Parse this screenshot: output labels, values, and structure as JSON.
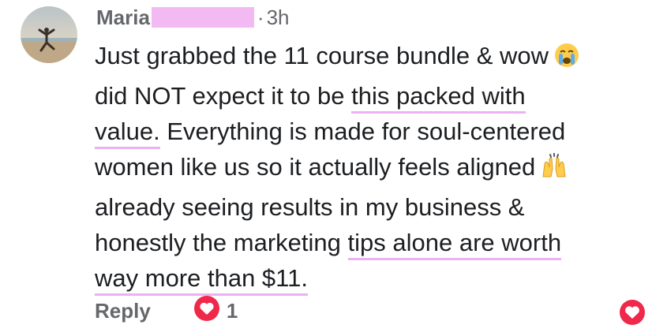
{
  "comment": {
    "author": "Maria",
    "separator": "·",
    "time": "3h",
    "lines": [
      {
        "pre": "Just grabbed the 11 course bundle & wow",
        "hl": "",
        "post": ""
      },
      {
        "pre": "did NOT expect it to be ",
        "hl": "this packed with",
        "post": ""
      },
      {
        "pre": "",
        "hl": "value.",
        "post": " Everything is made for soul-centered"
      },
      {
        "pre": "women like us so it actually feels aligned",
        "hl": "",
        "post": ""
      },
      {
        "pre": "already seeing results in my business &",
        "hl": "",
        "post": ""
      },
      {
        "pre": "honestly the marketing ",
        "hl": "tips alone are worth",
        "post": ""
      },
      {
        "pre": "",
        "hl": "way more than $11.",
        "post": ""
      }
    ],
    "emojis": [
      "crying-face",
      "raising-hands"
    ]
  },
  "actions": {
    "reply_label": "Reply",
    "reaction_count": "1"
  },
  "colors": {
    "heart_red": "#f0284a",
    "highlight_pink": "#ebb1f2",
    "muted_text": "#65676b"
  }
}
